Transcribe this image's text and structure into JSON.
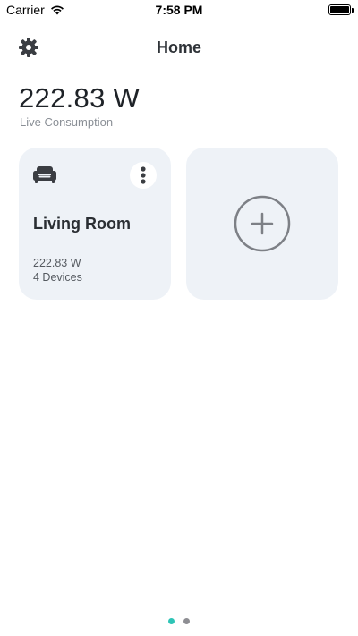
{
  "status_bar": {
    "carrier": "Carrier",
    "time": "7:58 PM",
    "battery_level": 1.0
  },
  "header": {
    "title": "Home",
    "settings_icon": "gear-icon"
  },
  "consumption": {
    "value": "222.83 W",
    "label": "Live Consumption"
  },
  "rooms": [
    {
      "icon": "sofa-icon",
      "name": "Living Room",
      "power": "222.83 W",
      "devices": "4 Devices",
      "menu_icon": "more-vertical-icon"
    }
  ],
  "add_room": {
    "icon": "plus-circle-icon"
  },
  "pagination": {
    "page_count": 2,
    "active_index": 0,
    "active_color": "#2ec4b6",
    "inactive_color": "#8e8e93"
  },
  "colors": {
    "card_background": "#eef2f7",
    "text_primary": "#1f2328",
    "text_secondary": "#8a8f96"
  }
}
